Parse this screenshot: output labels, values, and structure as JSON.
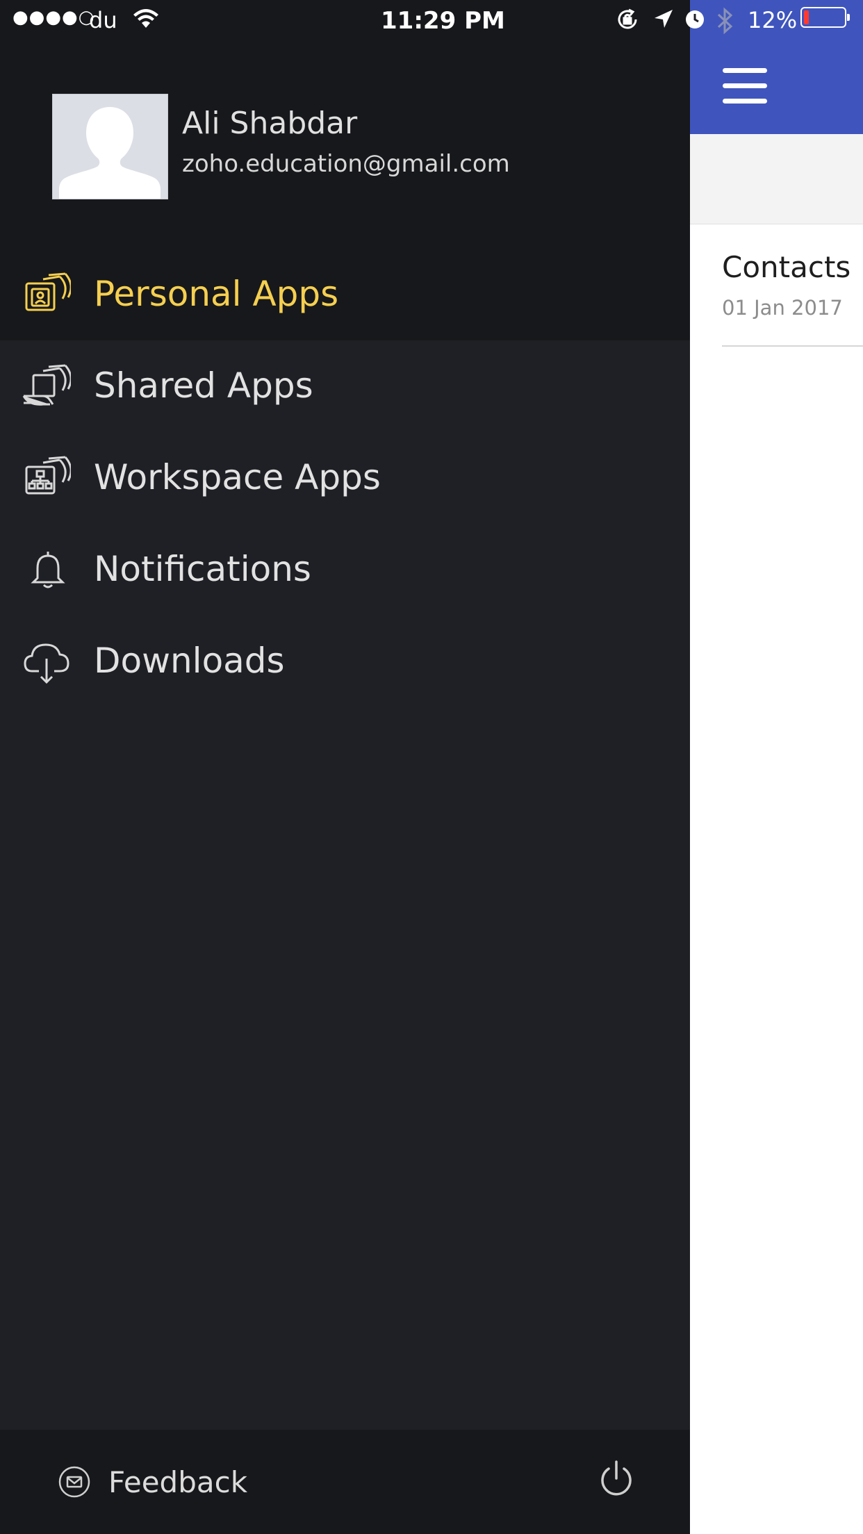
{
  "status_bar": {
    "signal": "●●●●○",
    "carrier": "du",
    "time": "11:29 PM",
    "battery_percent_text": "12%",
    "battery_level": 0.12,
    "battery_color": "#ff3b30"
  },
  "profile": {
    "name": "Ali Shabdar",
    "email": "zoho.education@gmail.com"
  },
  "menu": {
    "items": [
      {
        "label": "Personal Apps",
        "icon": "personal-apps-icon",
        "active": true
      },
      {
        "label": "Shared Apps",
        "icon": "shared-apps-icon",
        "active": false
      },
      {
        "label": "Workspace Apps",
        "icon": "workspace-apps-icon",
        "active": false
      },
      {
        "label": "Notifications",
        "icon": "bell-icon",
        "active": false
      },
      {
        "label": "Downloads",
        "icon": "cloud-download-icon",
        "active": false
      }
    ]
  },
  "footer": {
    "feedback_label": "Feedback",
    "feedback_icon": "mail-icon",
    "power_icon": "power-icon"
  },
  "app": {
    "header_color": "#3f55bd",
    "menu_icon": "hamburger-menu-icon",
    "item_title": "Contacts",
    "item_date": "01 Jan 2017"
  },
  "colors": {
    "accent_active": "#f5cf50",
    "drawer_bg": "#1f2025",
    "drawer_dark": "#17181b"
  }
}
